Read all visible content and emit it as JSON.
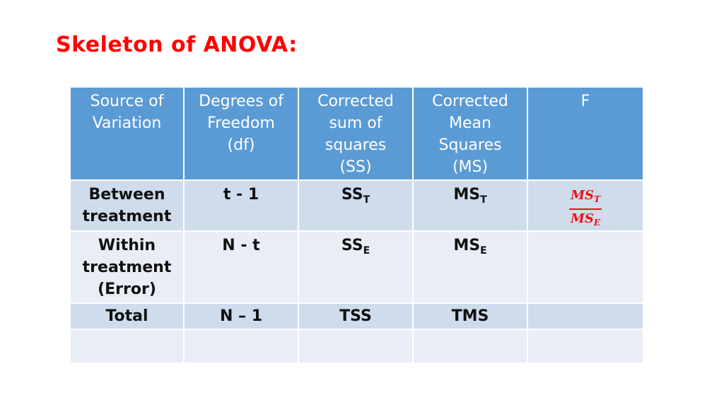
{
  "slide": {
    "title": "Skeleton of ANOVA:"
  },
  "table": {
    "headers": [
      {
        "lines": [
          "Source of",
          "Variation"
        ]
      },
      {
        "lines": [
          "Degrees of",
          "Freedom",
          "(df)"
        ]
      },
      {
        "lines": [
          "Corrected",
          "sum of",
          "squares",
          "(SS)"
        ]
      },
      {
        "lines": [
          "Corrected",
          "Mean",
          "Squares",
          "(MS)"
        ]
      },
      {
        "lines": [
          "F"
        ]
      }
    ],
    "rows": [
      {
        "source": [
          "Between",
          "treatment"
        ],
        "df": "t - 1",
        "ss": {
          "base": "SS",
          "sub": "T"
        },
        "ms": {
          "base": "MS",
          "sub": "T"
        },
        "f": {
          "num_base": "MS",
          "num_sub": "T",
          "den_base": "MS",
          "den_sub": "E"
        }
      },
      {
        "source": [
          "Within",
          "treatment",
          "(Error)"
        ],
        "df": "N - t",
        "ss": {
          "base": "SS",
          "sub": "E"
        },
        "ms": {
          "base": "MS",
          "sub": "E"
        },
        "f": null
      },
      {
        "source": [
          "Total"
        ],
        "df": "N – 1",
        "ss": {
          "base": "TSS",
          "sub": ""
        },
        "ms": {
          "base": "TMS",
          "sub": ""
        },
        "f": null
      },
      {
        "source": [],
        "df": "",
        "ss": {
          "base": "",
          "sub": ""
        },
        "ms": {
          "base": "",
          "sub": ""
        },
        "f": null
      }
    ]
  },
  "colors": {
    "title": "#ff0000",
    "header_bg": "#5b9bd5",
    "row_dark": "#cfdcec",
    "row_light": "#e9edf5",
    "formula": "#ee1111"
  }
}
